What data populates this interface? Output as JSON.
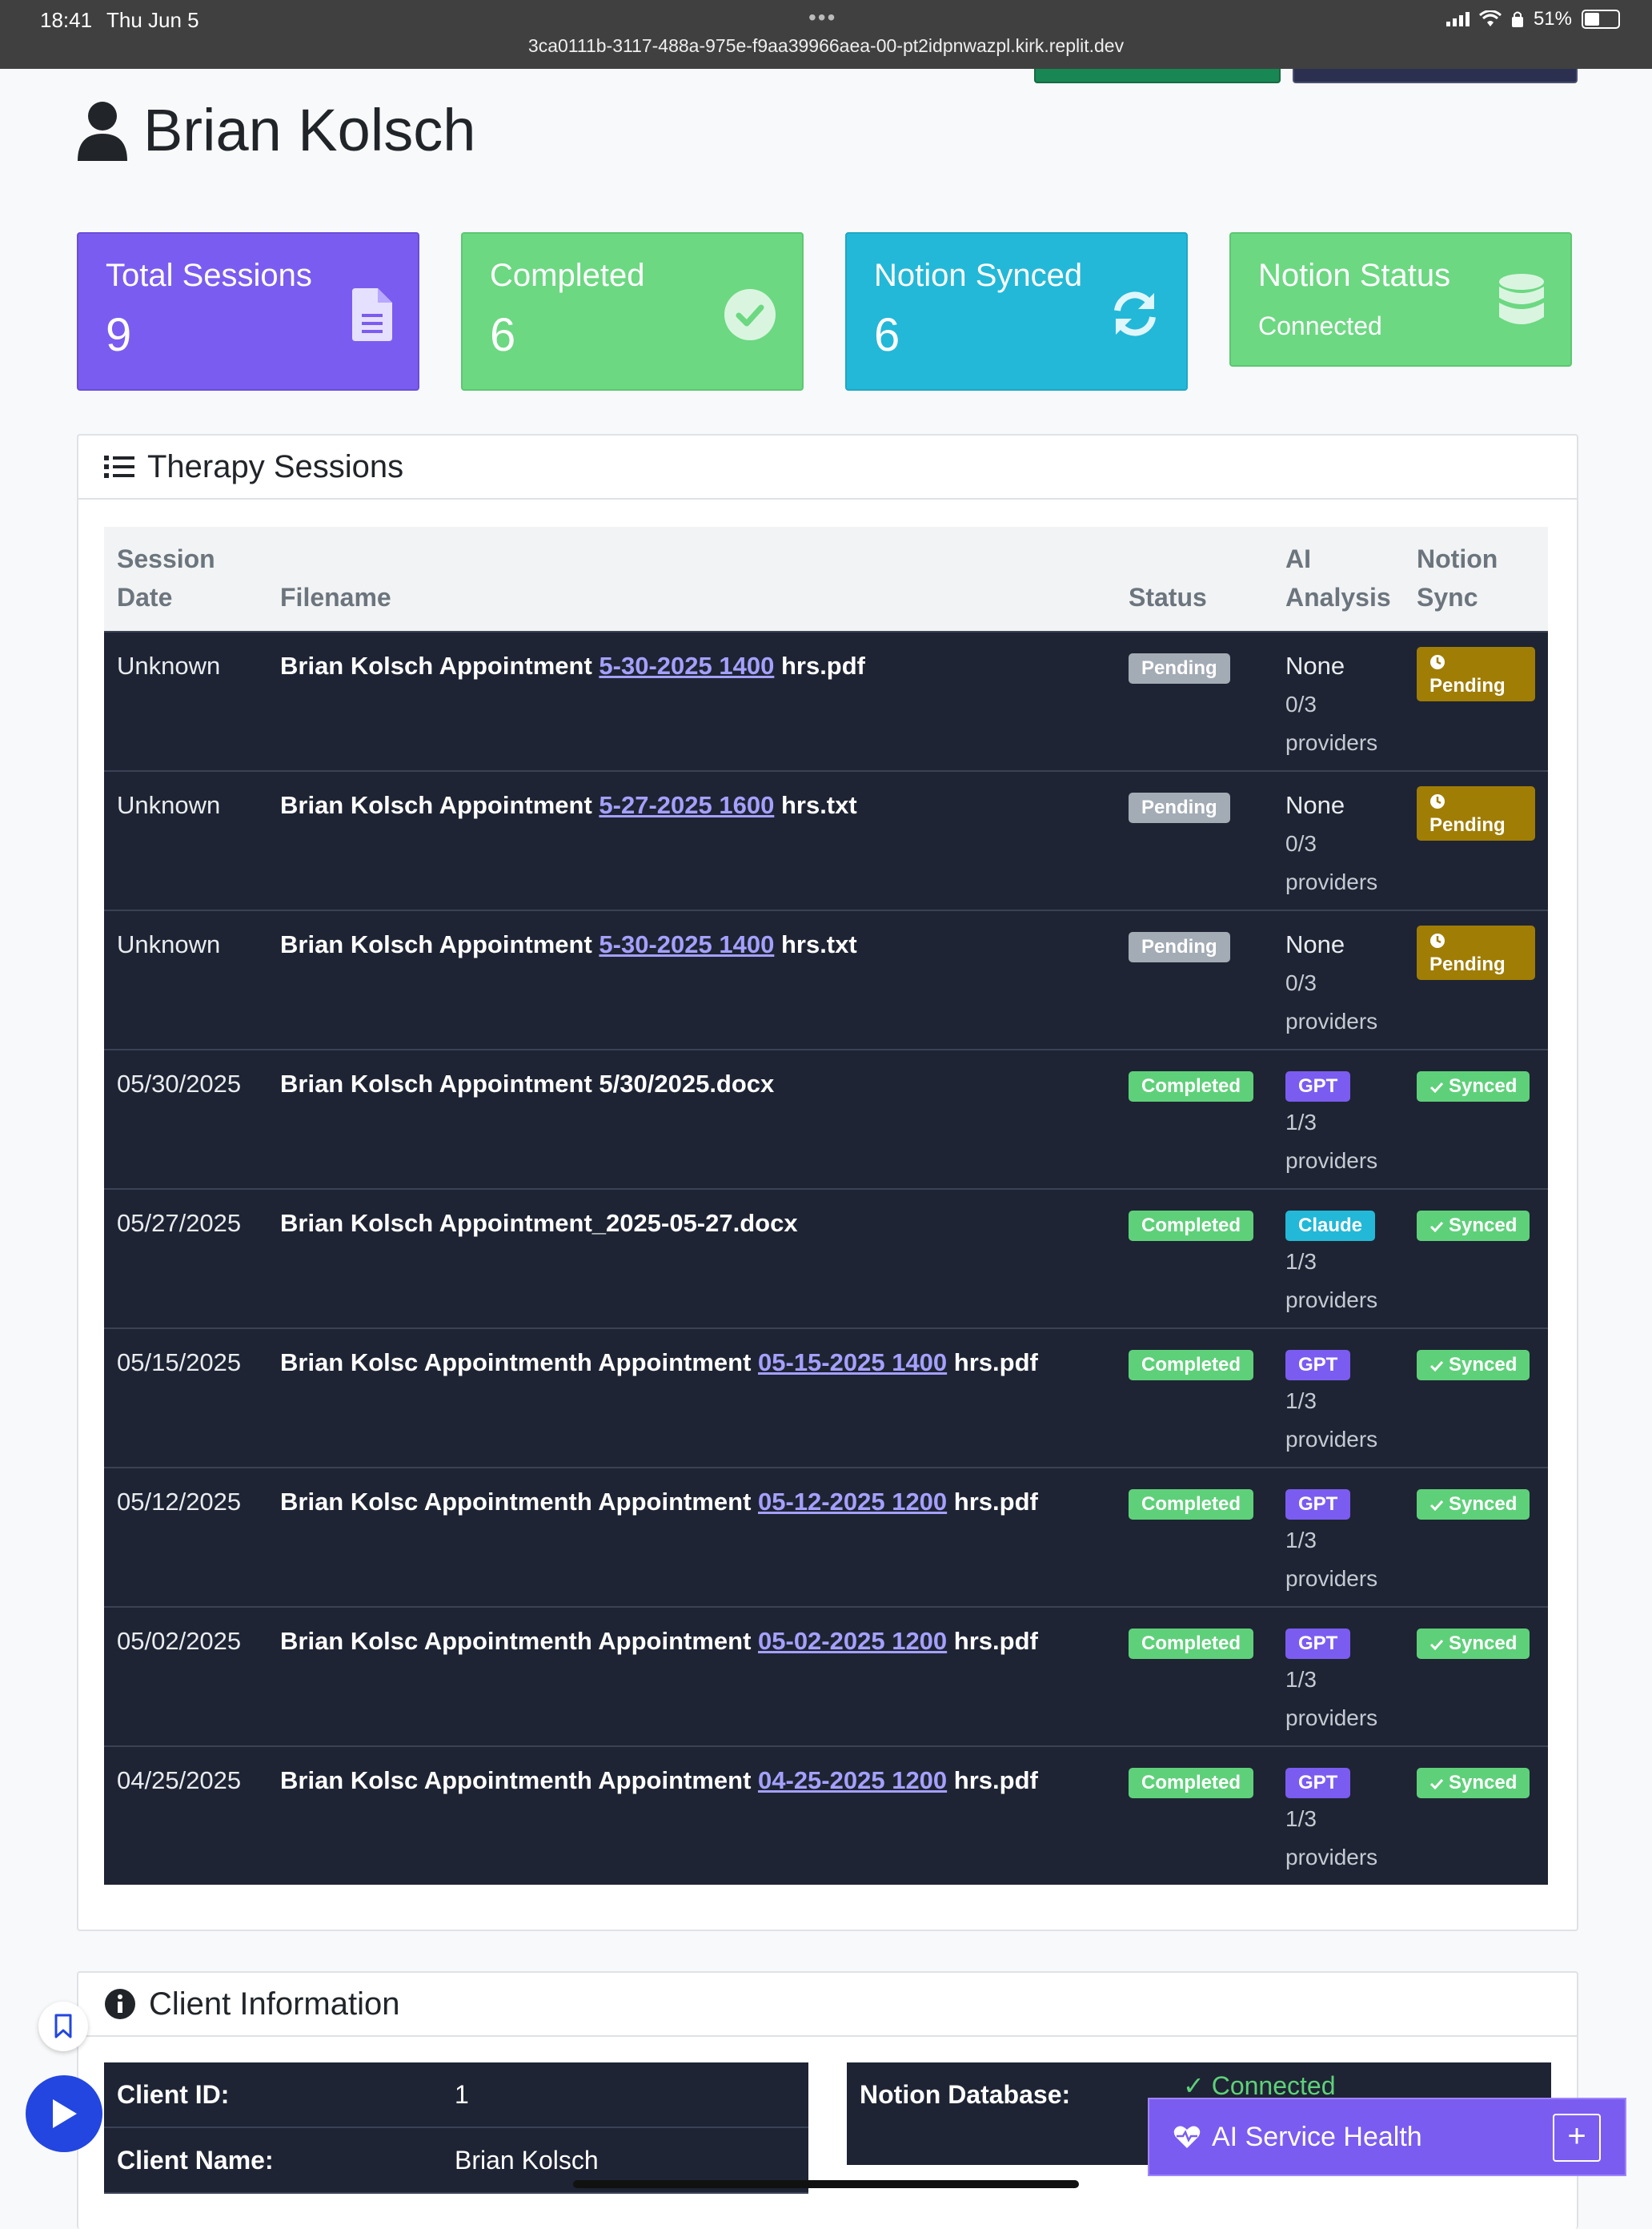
{
  "statusbar": {
    "time": "18:41",
    "date": "Thu Jun 5",
    "url": "3ca0111b-3117-488a-975e-f9aa39966aea-00-pt2idpnwazpl.kirk.replit.dev",
    "battery": "51%"
  },
  "page": {
    "title": "Brian Kolsch"
  },
  "cards": [
    {
      "label": "Total Sessions",
      "value": "9",
      "icon": "file-icon",
      "color": "#7b5cf0"
    },
    {
      "label": "Completed",
      "value": "6",
      "icon": "check-circle-icon",
      "color": "#6cd882"
    },
    {
      "label": "Notion Synced",
      "value": "6",
      "icon": "sync-icon",
      "color": "#23b8d8"
    },
    {
      "label": "Notion Status",
      "value": "Connected",
      "icon": "database-icon",
      "color": "#6cd882"
    }
  ],
  "sessions": {
    "title": "Therapy Sessions",
    "headers": {
      "date_1": "Session",
      "date_2": "Date",
      "filename": "Filename",
      "status": "Status",
      "ai_1": "AI",
      "ai_2": "Analysis",
      "notion_1": "Notion",
      "notion_2": "Sync"
    },
    "rows": [
      {
        "date": "Unknown",
        "pre": "Brian Kolsch Appointment ",
        "link": "5-30-2025 1400",
        "post": " hrs.pdf",
        "status": "Pending",
        "ai": "None",
        "ai_count": "0/3",
        "providers": "providers",
        "notion": "Pending"
      },
      {
        "date": "Unknown",
        "pre": "Brian Kolsch Appointment ",
        "link": "5-27-2025 1600",
        "post": " hrs.txt",
        "status": "Pending",
        "ai": "None",
        "ai_count": "0/3",
        "providers": "providers",
        "notion": "Pending"
      },
      {
        "date": "Unknown",
        "pre": "Brian Kolsch Appointment ",
        "link": "5-30-2025 1400",
        "post": " hrs.txt",
        "status": "Pending",
        "ai": "None",
        "ai_count": "0/3",
        "providers": "providers",
        "notion": "Pending"
      },
      {
        "date": "05/30/2025",
        "pre": "Brian Kolsch Appointment 5/30/2025.docx",
        "link": "",
        "post": "",
        "status": "Completed",
        "ai": "GPT",
        "ai_count": "1/3",
        "providers": "providers",
        "notion": "Synced"
      },
      {
        "date": "05/27/2025",
        "pre": "Brian Kolsch Appointment_2025-05-27.docx",
        "link": "",
        "post": "",
        "status": "Completed",
        "ai": "Claude",
        "ai_count": "1/3",
        "providers": "providers",
        "notion": "Synced"
      },
      {
        "date": "05/15/2025",
        "pre": "Brian Kolsc Appointmenth Appointment ",
        "link": "05-15-2025 1400",
        "post": " hrs.pdf",
        "status": "Completed",
        "ai": "GPT",
        "ai_count": "1/3",
        "providers": "providers",
        "notion": "Synced"
      },
      {
        "date": "05/12/2025",
        "pre": "Brian Kolsc Appointmenth Appointment ",
        "link": "05-12-2025 1200",
        "post": " hrs.pdf",
        "status": "Completed",
        "ai": "GPT",
        "ai_count": "1/3",
        "providers": "providers",
        "notion": "Synced"
      },
      {
        "date": "05/02/2025",
        "pre": "Brian Kolsc Appointmenth Appointment ",
        "link": "05-02-2025 1200",
        "post": " hrs.pdf",
        "status": "Completed",
        "ai": "GPT",
        "ai_count": "1/3",
        "providers": "providers",
        "notion": "Synced"
      },
      {
        "date": "04/25/2025",
        "pre": "Brian Kolsc Appointmenth Appointment ",
        "link": "04-25-2025 1200",
        "post": " hrs.pdf",
        "status": "Completed",
        "ai": "GPT",
        "ai_count": "1/3",
        "providers": "providers",
        "notion": "Synced"
      }
    ]
  },
  "client_info": {
    "title": "Client Information",
    "client_id_label": "Client ID:",
    "client_id": "1",
    "client_name_label": "Client Name:",
    "client_name": "Brian Kolsch",
    "notion_db_label": "Notion Database:",
    "notion_db_value": "✓ Connected"
  },
  "ai_health": {
    "label": "AI Service Health",
    "plus": "+"
  }
}
